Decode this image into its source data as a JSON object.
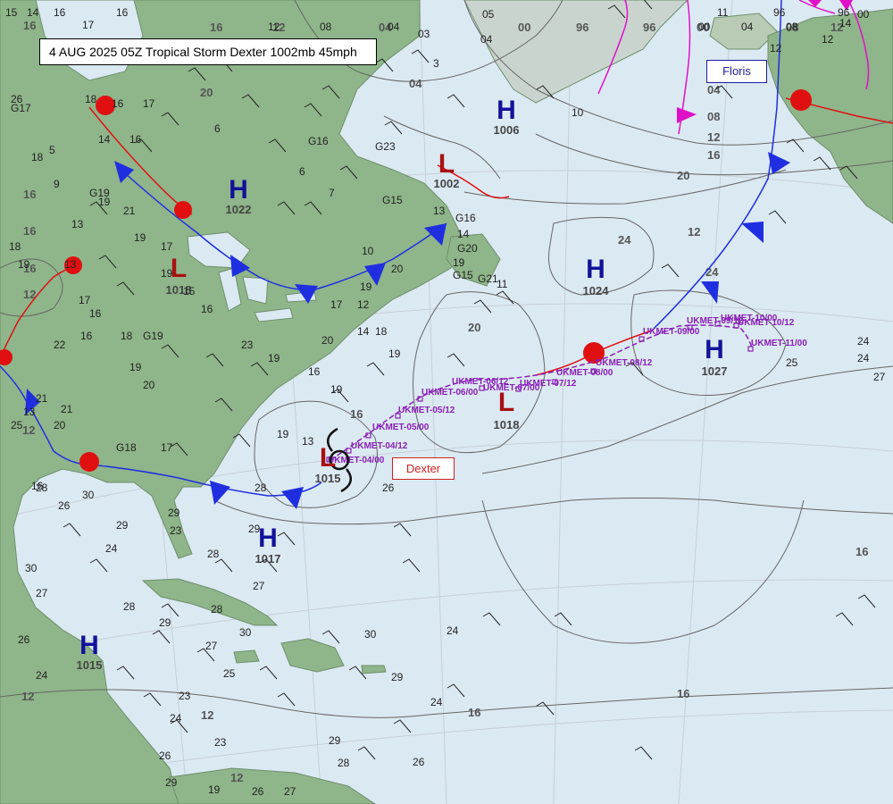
{
  "title": "4 AUG 2025 05Z Tropical Storm Dexter 1002mb 45mph",
  "storm_labels": {
    "floris": "Floris",
    "dexter": "Dexter"
  },
  "colors": {
    "ocean": "#dbe9f3",
    "land": "#8fb58a",
    "high": "#12129a",
    "low": "#a81010",
    "cold_front": "#1f2fe0",
    "warm_front": "#e01010",
    "track": "#8a1fb5",
    "tropical_wave": "#e010c8",
    "isobar": "#666666",
    "graticule": "#c6cfd6"
  },
  "pressure_centers": [
    {
      "type": "H",
      "value": "1006"
    },
    {
      "type": "H",
      "value": "1022"
    },
    {
      "type": "L",
      "value": "1018"
    },
    {
      "type": "L",
      "value": "1002"
    },
    {
      "type": "H",
      "value": "1024"
    },
    {
      "type": "H",
      "value": "1027"
    },
    {
      "type": "L",
      "value": "1018"
    },
    {
      "type": "L",
      "value": "1015"
    },
    {
      "type": "H",
      "value": "1017"
    },
    {
      "type": "H",
      "value": "1015"
    }
  ],
  "isobar_labels": [
    "04",
    "04",
    "00",
    "96",
    "96",
    "00",
    "04",
    "08",
    "12",
    "08",
    "12",
    "16",
    "12",
    "16",
    "20",
    "20",
    "24",
    "24",
    "20",
    "16",
    "16",
    "16",
    "16",
    "16",
    "12",
    "12",
    "12",
    "12",
    "12",
    "16",
    "16",
    "16",
    "12"
  ],
  "track_points": [
    "UKMET-04/00",
    "UKMET-04/12",
    "UKMET-05/00",
    "UKMET-05/12",
    "UKMET-06/00",
    "UKMET-06/12",
    "UKMET-07/00",
    "UKMET-07/12",
    "UKMET-08/00",
    "UKMET-08/12",
    "UKMET-09/00",
    "UKMET-09/12",
    "UKMET-10/00",
    "UKMET-10/12",
    "UKMET-11/00"
  ],
  "station_values": [
    "15",
    "14",
    "16",
    "17",
    "16",
    "12",
    "08",
    "04",
    "03",
    "05",
    "04",
    "00",
    "96",
    "96",
    "00",
    "11",
    "04",
    "08",
    "12",
    "14",
    "12",
    "26",
    "G17",
    "18",
    "16",
    "17",
    "14",
    "16",
    "G19",
    "3",
    "10",
    "G16",
    "6",
    "G23",
    "7",
    "G15",
    "13",
    "G16",
    "14",
    "G20",
    "19",
    "G15",
    "G21",
    "11",
    "20",
    "6",
    "18",
    "9",
    "13",
    "5",
    "19",
    "21",
    "19",
    "17",
    "19",
    "15",
    "16",
    "16",
    "18",
    "G19",
    "13",
    "17",
    "18",
    "19",
    "22",
    "16",
    "19",
    "20",
    "23",
    "19",
    "G18",
    "17",
    "19",
    "14",
    "18",
    "19",
    "19",
    "16",
    "20",
    "17",
    "12",
    "19",
    "10",
    "13",
    "26",
    "28",
    "23",
    "24",
    "26",
    "28",
    "30",
    "29",
    "29",
    "30",
    "27",
    "28",
    "29",
    "26",
    "24",
    "28",
    "29",
    "27",
    "28",
    "30",
    "27",
    "25",
    "23",
    "24",
    "26",
    "29",
    "19",
    "23",
    "25",
    "13",
    "16",
    "20",
    "21",
    "21",
    "25",
    "24",
    "24",
    "27",
    "26",
    "27",
    "28",
    "26",
    "29",
    "30",
    "29",
    "24",
    "24"
  ]
}
